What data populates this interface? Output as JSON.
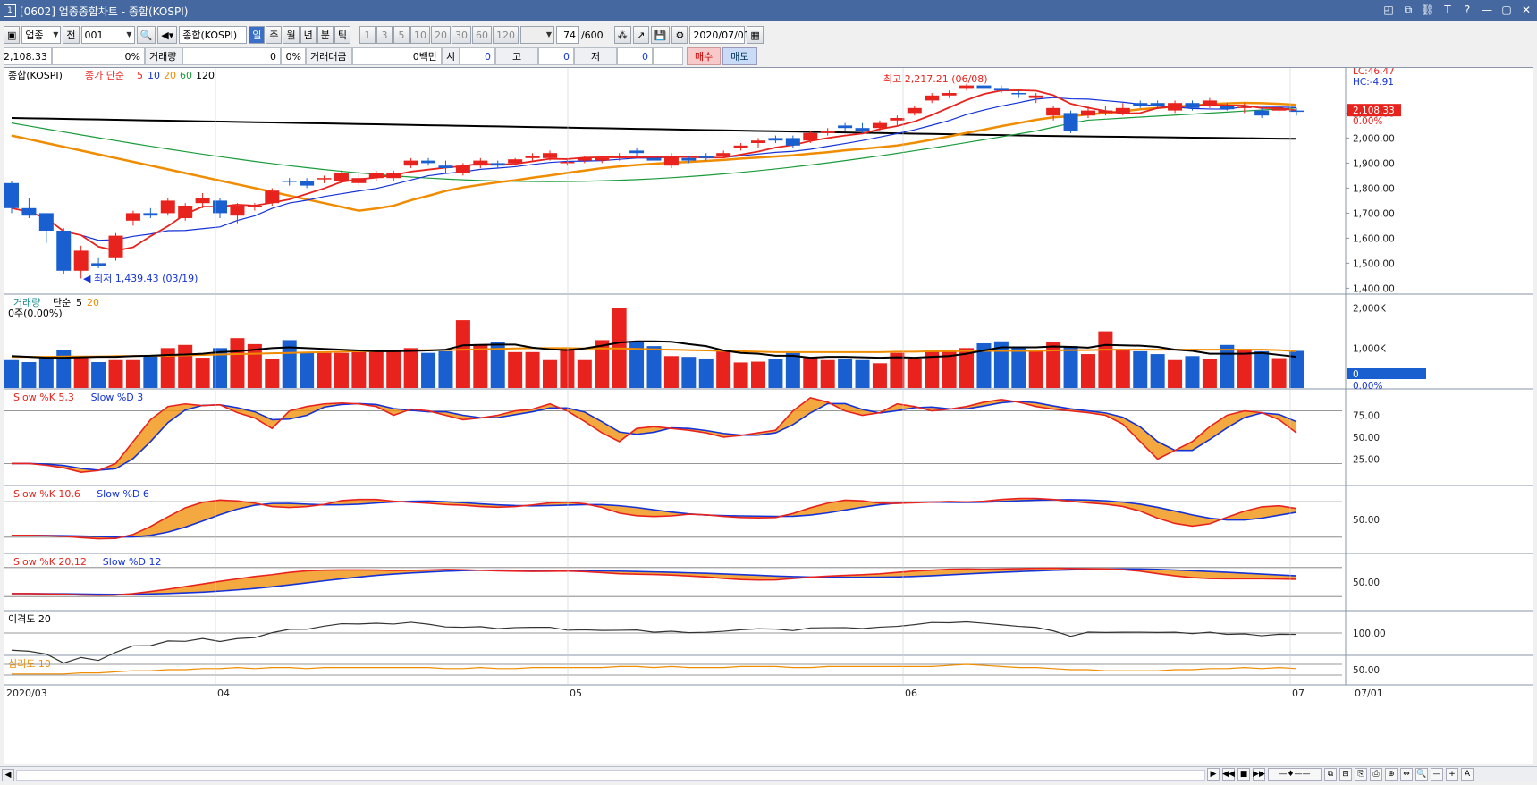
{
  "window": {
    "title": "[0602] 업종종합차트 - 종합(KOSPI)",
    "app_icon": "1",
    "controls": [
      "layout-icon",
      "pin-icon",
      "link-icon",
      "text-icon",
      "help-icon",
      "minimize-icon",
      "maximize-icon",
      "close-icon"
    ],
    "controls_glyph": [
      "◰",
      "⧉",
      "⛓",
      "T",
      "?",
      "—",
      "▢",
      "✕"
    ]
  },
  "toolbar": {
    "market": "업종",
    "prev_label": "전",
    "code": "001",
    "name": "종합(KOSPI)",
    "periods": [
      "일",
      "주",
      "월",
      "년",
      "분",
      "틱"
    ],
    "selected_period": "일",
    "minute_options": [
      "1",
      "3",
      "5",
      "10",
      "20",
      "30",
      "60",
      "120"
    ],
    "count": "74",
    "count_total": "/600",
    "date": "2020/07/01"
  },
  "info": {
    "price": "2,108.33",
    "change_pct": "0%",
    "volume_label": "거래량",
    "volume_value": "0",
    "volume_pct": "0%",
    "amount_label": "거래대금",
    "amount_value": "0백만",
    "open_label": "시",
    "open_value": "0",
    "high_label": "고",
    "high_value": "0",
    "low_label": "저",
    "low_value": "0",
    "buy_label": "매수",
    "sell_label": "매도"
  },
  "chart_data": [
    {
      "type": "candlestick",
      "panel": "price",
      "title": "종합(KOSPI)",
      "legend_prefix": "종가 단순",
      "ma_periods": [
        "5",
        "10",
        "20",
        "60",
        "120"
      ],
      "ma_colors": [
        "#e8231e",
        "#1432d8",
        "#f08c00",
        "#1a9b3c",
        "#000000"
      ],
      "lc": "LC:46.47",
      "hc": "HC:-4.91",
      "current_label": "2,108.33",
      "current_pct": "0.00%",
      "annotation_high": "최고 2,217.21 (06/08)",
      "annotation_low": "최저 1,439.43 (03/19)",
      "y_ticks": [
        "2,100.00",
        "2,000.00",
        "1,900.00",
        "1,800.00",
        "1,700.00",
        "1,600.00",
        "1,500.00",
        "1,400.00"
      ],
      "ylim": [
        1380,
        2280
      ],
      "candles": [
        [
          1820,
          1830,
          1700,
          1720
        ],
        [
          1720,
          1760,
          1680,
          1690
        ],
        [
          1700,
          1700,
          1580,
          1630
        ],
        [
          1630,
          1640,
          1455,
          1470
        ],
        [
          1470,
          1570,
          1439,
          1550
        ],
        [
          1500,
          1520,
          1480,
          1490
        ],
        [
          1520,
          1620,
          1510,
          1610
        ],
        [
          1670,
          1710,
          1650,
          1700
        ],
        [
          1700,
          1720,
          1680,
          1690
        ],
        [
          1700,
          1760,
          1690,
          1750
        ],
        [
          1680,
          1740,
          1670,
          1730
        ],
        [
          1740,
          1780,
          1720,
          1760
        ],
        [
          1750,
          1760,
          1680,
          1700
        ],
        [
          1690,
          1740,
          1660,
          1730
        ],
        [
          1725,
          1740,
          1710,
          1730
        ],
        [
          1740,
          1800,
          1730,
          1790
        ],
        [
          1830,
          1840,
          1810,
          1825
        ],
        [
          1830,
          1840,
          1800,
          1810
        ],
        [
          1840,
          1850,
          1820,
          1840
        ],
        [
          1830,
          1870,
          1820,
          1860
        ],
        [
          1820,
          1860,
          1810,
          1840
        ],
        [
          1840,
          1870,
          1830,
          1860
        ],
        [
          1840,
          1870,
          1830,
          1860
        ],
        [
          1890,
          1920,
          1880,
          1910
        ],
        [
          1910,
          1920,
          1890,
          1900
        ],
        [
          1890,
          1910,
          1860,
          1880
        ],
        [
          1860,
          1900,
          1850,
          1890
        ],
        [
          1890,
          1920,
          1880,
          1910
        ],
        [
          1900,
          1910,
          1880,
          1890
        ],
        [
          1900,
          1920,
          1890,
          1915
        ],
        [
          1920,
          1940,
          1910,
          1930
        ],
        [
          1920,
          1950,
          1910,
          1940
        ],
        [
          1900,
          1920,
          1890,
          1905
        ],
        [
          1910,
          1930,
          1900,
          1920
        ],
        [
          1910,
          1930,
          1900,
          1920
        ],
        [
          1920,
          1940,
          1910,
          1930
        ],
        [
          1950,
          1960,
          1930,
          1940
        ],
        [
          1920,
          1940,
          1900,
          1910
        ],
        [
          1890,
          1940,
          1880,
          1930
        ],
        [
          1920,
          1930,
          1900,
          1910
        ],
        [
          1930,
          1940,
          1910,
          1920
        ],
        [
          1930,
          1950,
          1920,
          1940
        ],
        [
          1960,
          1980,
          1950,
          1970
        ],
        [
          1980,
          2000,
          1960,
          1990
        ],
        [
          2000,
          2010,
          1980,
          1990
        ],
        [
          2000,
          2010,
          1960,
          1970
        ],
        [
          1990,
          2030,
          1980,
          2020
        ],
        [
          2020,
          2040,
          2010,
          2030
        ],
        [
          2050,
          2060,
          2030,
          2040
        ],
        [
          2040,
          2060,
          2020,
          2030
        ],
        [
          2040,
          2070,
          2030,
          2060
        ],
        [
          2070,
          2090,
          2050,
          2080
        ],
        [
          2100,
          2130,
          2090,
          2120
        ],
        [
          2150,
          2180,
          2140,
          2170
        ],
        [
          2170,
          2190,
          2160,
          2180
        ],
        [
          2200,
          2217,
          2190,
          2210
        ],
        [
          2210,
          2217,
          2190,
          2200
        ],
        [
          2200,
          2210,
          2180,
          2190
        ],
        [
          2180,
          2190,
          2160,
          2175
        ],
        [
          2160,
          2180,
          2140,
          2170
        ],
        [
          2090,
          2130,
          2070,
          2120
        ],
        [
          2100,
          2110,
          2020,
          2030
        ],
        [
          2090,
          2130,
          2080,
          2110
        ],
        [
          2100,
          2130,
          2090,
          2110
        ],
        [
          2100,
          2140,
          2090,
          2120
        ],
        [
          2140,
          2150,
          2120,
          2130
        ],
        [
          2140,
          2150,
          2120,
          2130
        ],
        [
          2110,
          2150,
          2100,
          2140
        ],
        [
          2140,
          2150,
          2110,
          2120
        ],
        [
          2130,
          2160,
          2120,
          2150
        ],
        [
          2130,
          2140,
          2110,
          2115
        ],
        [
          2120,
          2140,
          2100,
          2125
        ],
        [
          2110,
          2120,
          2080,
          2090
        ],
        [
          2110,
          2130,
          2100,
          2115
        ],
        [
          2110,
          2120,
          2090,
          2108
        ]
      ]
    },
    {
      "type": "bar",
      "panel": "volume",
      "title": "거래량",
      "legend_prefix": "단순",
      "ma_periods": [
        "5",
        "20"
      ],
      "ma_colors": [
        "#000000",
        "#f08c00"
      ],
      "sub": "0주(0.00%)",
      "y_ticks": [
        "2,000K",
        "1,000K"
      ],
      "current_label": "0",
      "current_pct": "0.00%",
      "ylim": [
        0,
        2150
      ],
      "values": [
        700,
        650,
        750,
        950,
        780,
        650,
        700,
        700,
        820,
        1000,
        1080,
        760,
        1000,
        1250,
        1100,
        720,
        1200,
        900,
        880,
        880,
        900,
        920,
        940,
        1000,
        880,
        920,
        1700,
        1100,
        1150,
        900,
        900,
        700,
        1000,
        700,
        1200,
        2000,
        1150,
        1050,
        800,
        780,
        740,
        950,
        640,
        660,
        730,
        880,
        760,
        700,
        740,
        700,
        620,
        880,
        720,
        920,
        950,
        1000,
        1120,
        1170,
        1000,
        950,
        1150,
        1050,
        850,
        1420,
        950,
        920,
        850,
        700,
        800,
        720,
        1080,
        980,
        920,
        750,
        930
      ],
      "ma5": [
        800,
        780,
        760,
        760,
        770,
        780,
        780,
        800,
        810,
        830,
        840,
        860,
        900,
        920,
        960,
        1000,
        1020,
        1000,
        980,
        960,
        940,
        920,
        920,
        930,
        940,
        960,
        1070,
        1080,
        1090,
        1090,
        1010,
        970,
        950,
        990,
        1060,
        1140,
        1170,
        1170,
        1160,
        1100,
        1050,
        940,
        880,
        860,
        810,
        810,
        760,
        780,
        780,
        770,
        760,
        770,
        760,
        780,
        800,
        860,
        940,
        1020,
        1020,
        1020,
        1040,
        1030,
        1010,
        1080,
        1070,
        1060,
        1030,
        960,
        930,
        860,
        860,
        860,
        880,
        830,
        780
      ],
      "ma20": [
        780,
        780,
        780,
        790,
        790,
        790,
        800,
        800,
        810,
        810,
        820,
        830,
        840,
        850,
        860,
        870,
        880,
        890,
        900,
        910,
        920,
        920,
        930,
        940,
        950,
        950,
        960,
        970,
        980,
        990,
        1000,
        1000,
        1000,
        990,
        990,
        990,
        980,
        970,
        960,
        950,
        940,
        930,
        920,
        910,
        900,
        900,
        900,
        900,
        900,
        900,
        900,
        910,
        910,
        920,
        920,
        930,
        930,
        930,
        930,
        930,
        940,
        950,
        950,
        960,
        960,
        960,
        960,
        960,
        960,
        960,
        960,
        960,
        960,
        950,
        920
      ]
    },
    {
      "type": "line",
      "panel": "stoch-5-3",
      "title_k": "Slow %K 5,3",
      "title_d": "Slow %D 3",
      "y_ticks": [
        "75.00",
        "50.00",
        "25.00"
      ],
      "ylim": [
        0,
        100
      ],
      "bands": [
        80,
        20
      ],
      "k": [
        20,
        20,
        18,
        15,
        10,
        12,
        20,
        45,
        70,
        85,
        88,
        86,
        87,
        78,
        72,
        60,
        80,
        85,
        88,
        89,
        88,
        85,
        75,
        82,
        80,
        75,
        70,
        72,
        75,
        80,
        82,
        88,
        80,
        68,
        55,
        45,
        60,
        62,
        60,
        58,
        55,
        50,
        52,
        55,
        58,
        80,
        95,
        90,
        80,
        75,
        78,
        88,
        85,
        80,
        82,
        85,
        90,
        93,
        90,
        85,
        82,
        80,
        78,
        75,
        65,
        45,
        25,
        35,
        45,
        62,
        75,
        80,
        78,
        70,
        55
      ]
    },
    {
      "type": "line",
      "panel": "stoch-10-6",
      "title_k": "Slow %K 10,6",
      "title_d": "Slow %D 6",
      "y_ticks": [
        "50.00"
      ],
      "ylim": [
        0,
        100
      ],
      "bands": [
        80,
        20
      ]
    },
    {
      "type": "line",
      "panel": "stoch-20-12",
      "title_k": "Slow %K 20,12",
      "title_d": "Slow %D 12",
      "y_ticks": [
        "50.00"
      ],
      "ylim": [
        0,
        100
      ],
      "bands": [
        80,
        20
      ]
    },
    {
      "type": "line",
      "panel": "disparity",
      "title": "이격도 20",
      "y_ticks": [
        "100.00"
      ],
      "ylim": [
        85,
        115
      ]
    },
    {
      "type": "line",
      "panel": "psychology",
      "title": "심리도 10",
      "y_ticks": [
        "50.00"
      ],
      "ylim": [
        0,
        100
      ]
    }
  ],
  "x_axis": {
    "labels": [
      "2020/03",
      "04",
      "05",
      "06",
      "07",
      "07/01"
    ]
  }
}
